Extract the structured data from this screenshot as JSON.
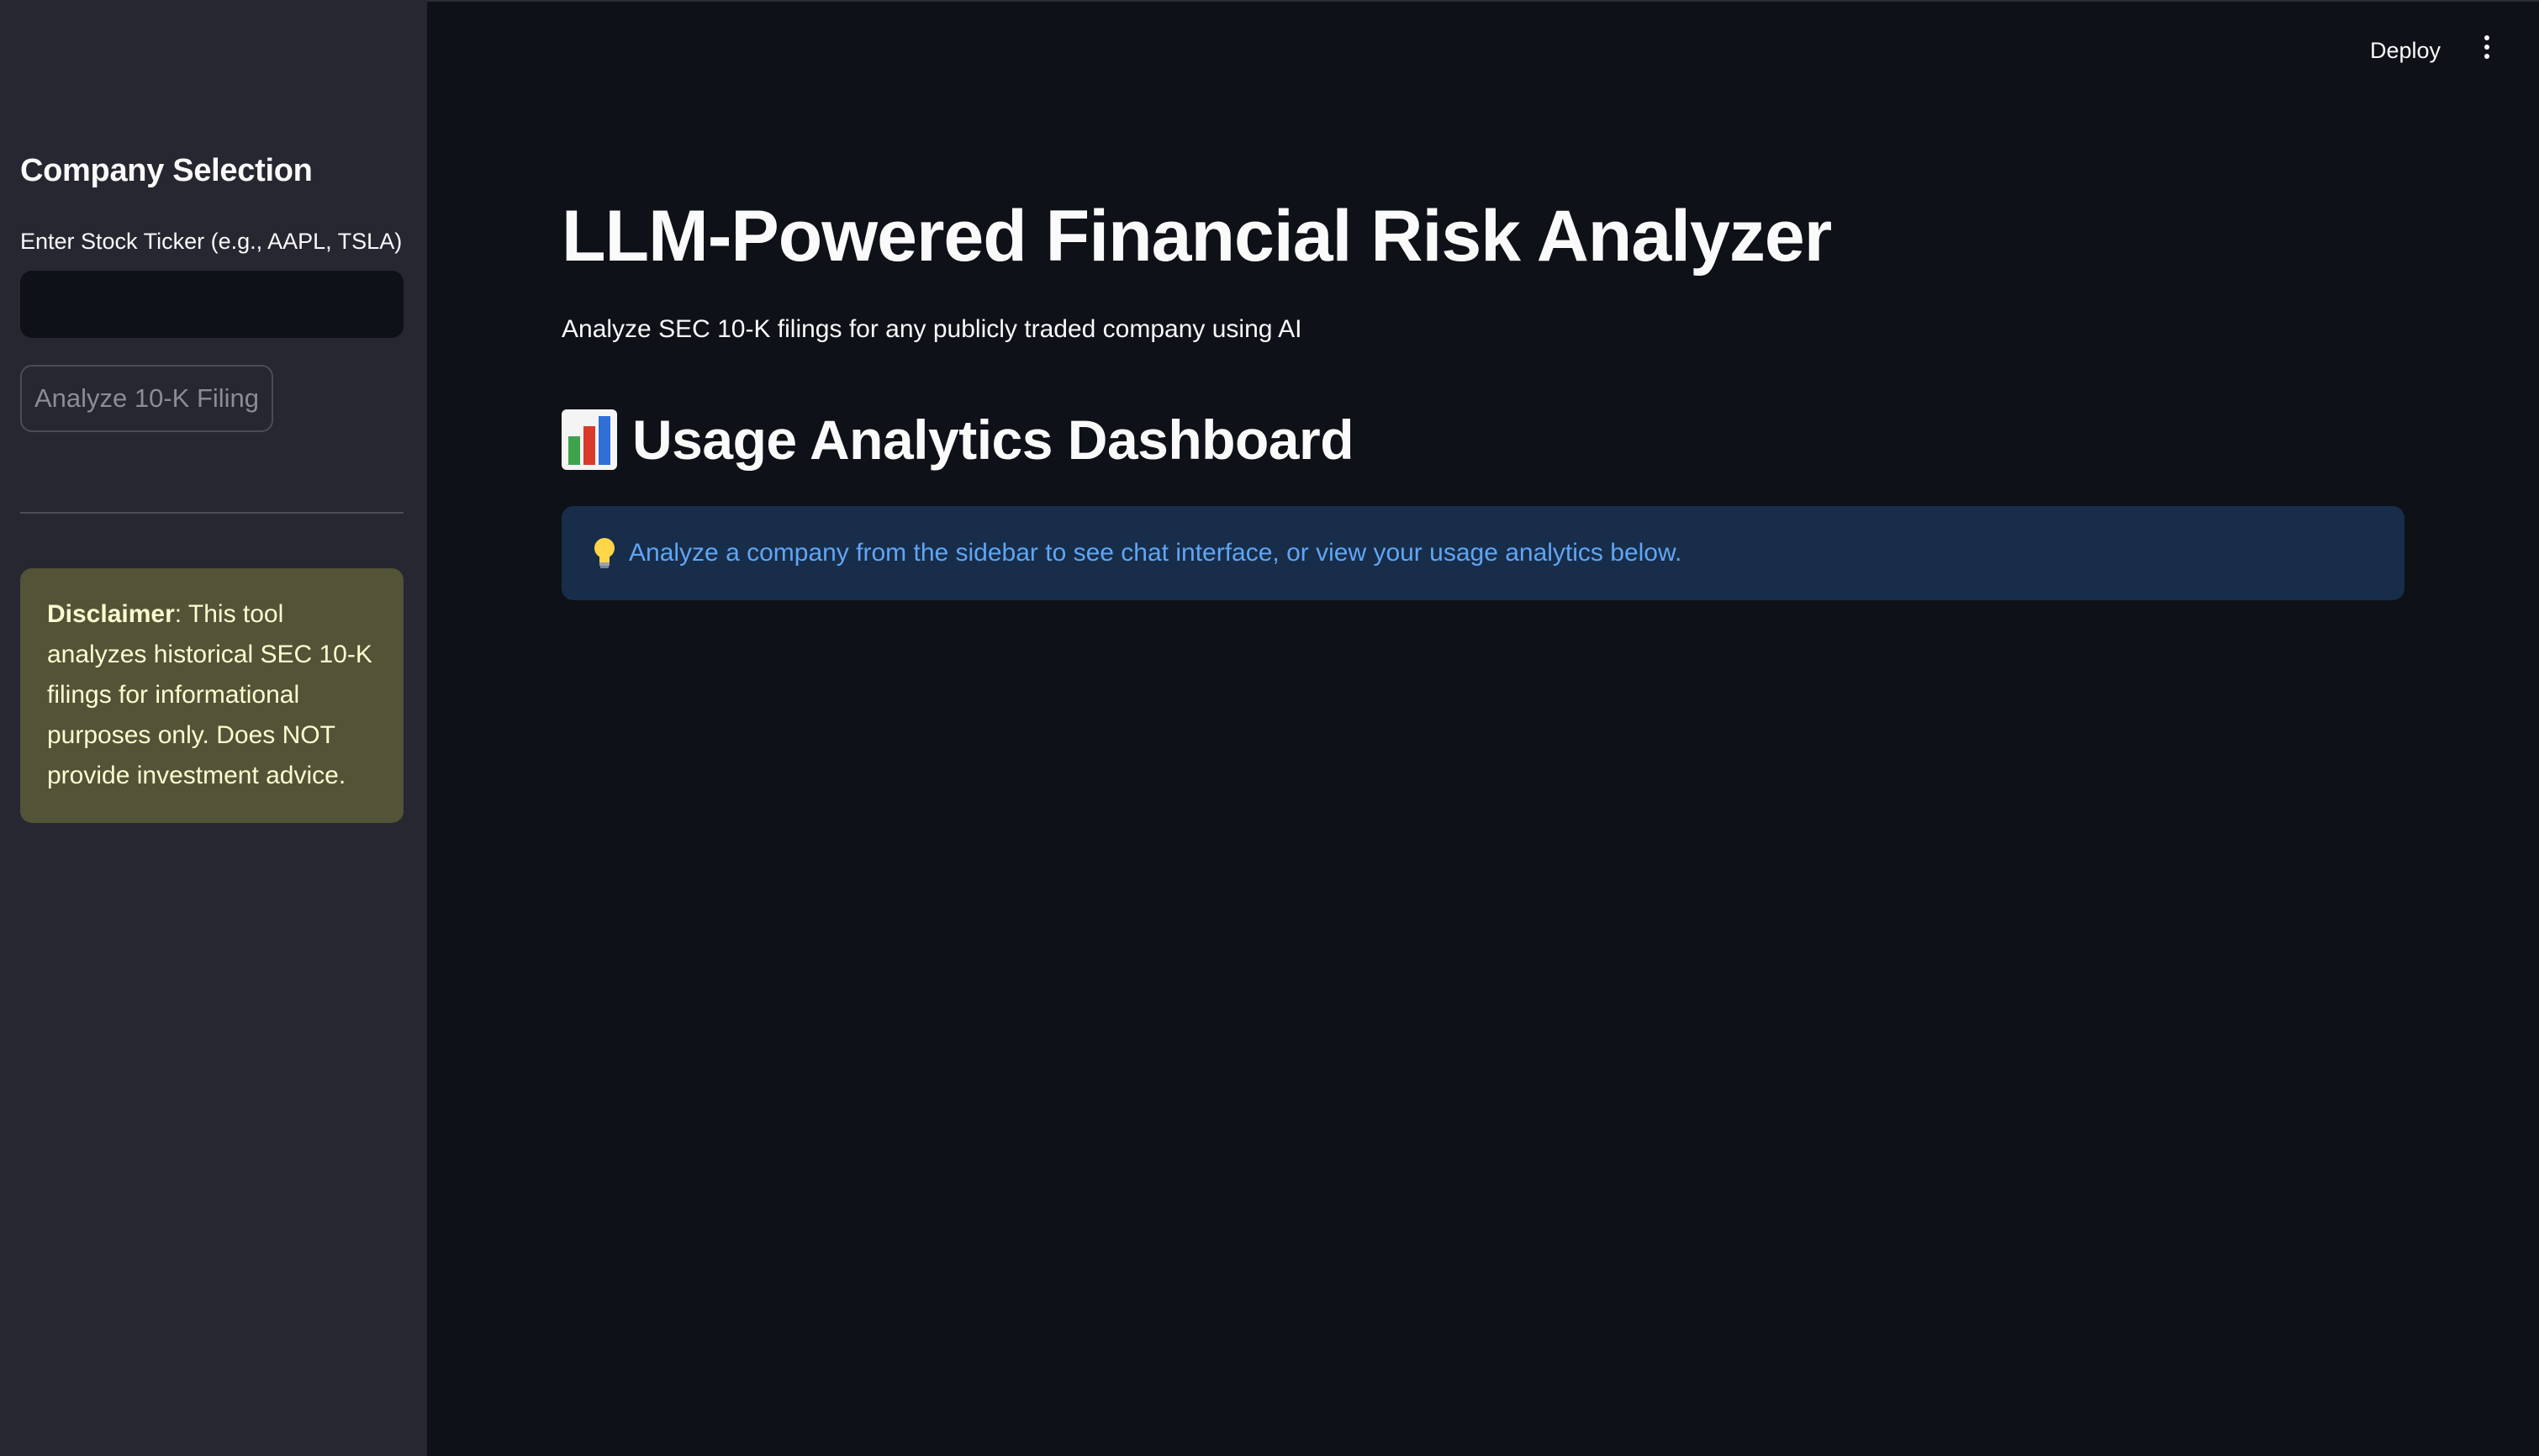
{
  "sidebar": {
    "header": "Company Selection",
    "ticker_label": "Enter Stock Ticker (e.g., AAPL, TSLA)",
    "ticker_value": "",
    "ticker_placeholder": "",
    "analyze_button": "Analyze 10-K Filing",
    "disclaimer": {
      "bold": "Disclaimer",
      "text": ": This tool analyzes historical SEC 10-K filings for informational purposes only. Does NOT provide investment advice."
    }
  },
  "toolbar": {
    "deploy_label": "Deploy",
    "menu_icon": "more-vertical-icon"
  },
  "main": {
    "title": "LLM-Powered Financial Risk Analyzer",
    "subtitle": "Analyze SEC 10-K filings for any publicly traded company using AI",
    "section_heading": "Usage Analytics Dashboard",
    "section_icon": "bar-chart-icon",
    "info_icon": "light-bulb-icon",
    "info_text": "Analyze a company from the sidebar to see chat interface, or view your usage analytics below."
  },
  "colors": {
    "background": "#0e1117",
    "sidebar": "#262730",
    "disclaimer_bg": "#525337",
    "disclaimer_text": "#fdfdd0",
    "info_bg": "#172d4a",
    "info_text": "#61a5f2"
  }
}
